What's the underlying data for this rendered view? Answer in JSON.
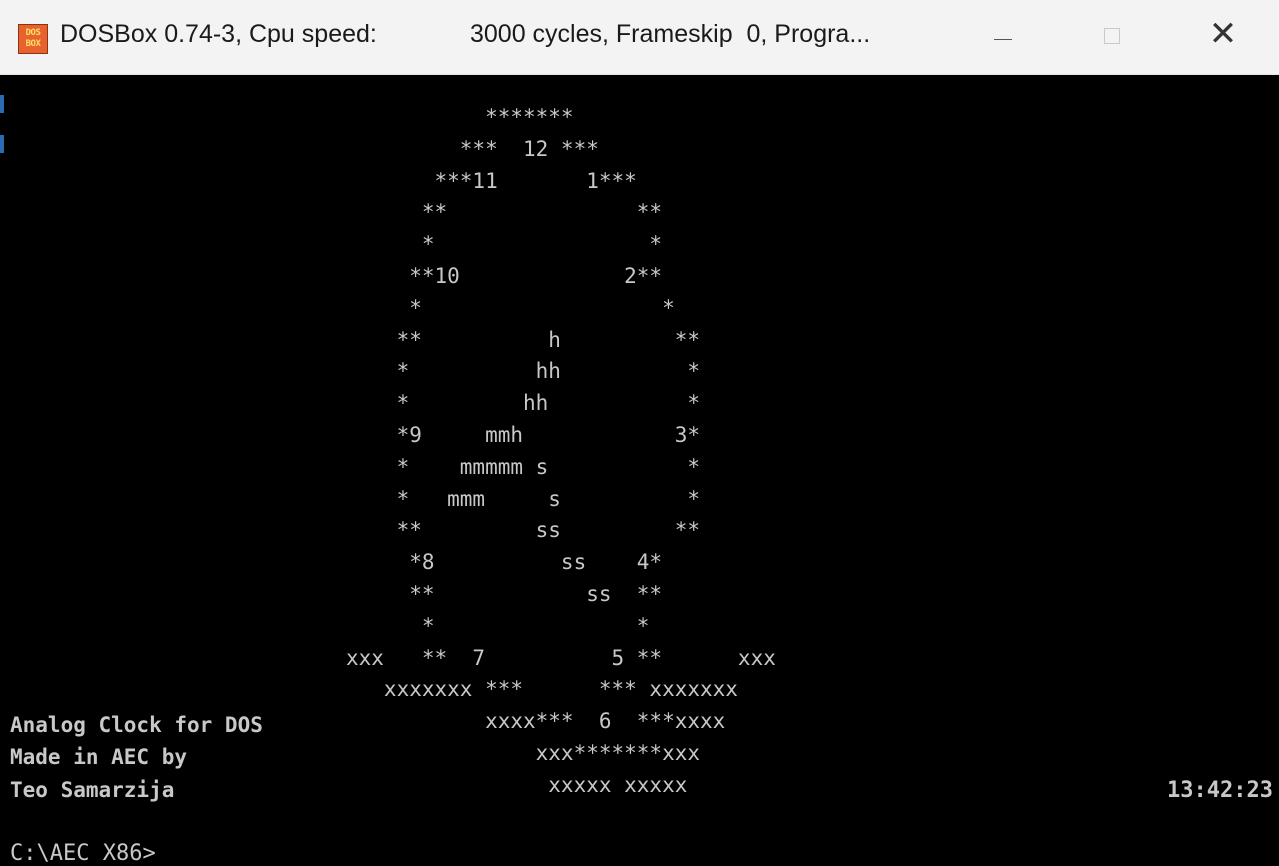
{
  "window": {
    "app_icon_text": "DOS\nBOX",
    "title_left": "DOSBox 0.74-3, Cpu speed:",
    "title_right": "3000 cycles, Frameskip  0, Progra...",
    "minimize_label": "—",
    "close_label": "✕"
  },
  "screen": {
    "clock_rows": [
      "           *******",
      "         ***  12 ***",
      "       ***11       1***",
      "      **               **",
      "      *                 *",
      "     **10             2**",
      "     *                   *",
      "    **          h         **",
      "    *          hh          *",
      "    *         hh           *",
      "    *9     mmh            3*",
      "    *    mmmmm s           *",
      "    *   mmm     s          *",
      "    **         ss         **",
      "     *8          ss    4*",
      "     **            ss  **",
      "      *                *",
      "xxx   **  7          5 **      xxx",
      "   xxxxxxx ***      *** xxxxxxx",
      "           xxxx***  6  ***xxxx",
      "               xxx*******xxx",
      "                xxxxx xxxxx"
    ],
    "info_lines": [
      "Analog Clock for DOS",
      "Made in AEC by",
      "Teo Samarzija"
    ],
    "time": "13:42:23",
    "prompt": "C:\\AEC X86>"
  }
}
